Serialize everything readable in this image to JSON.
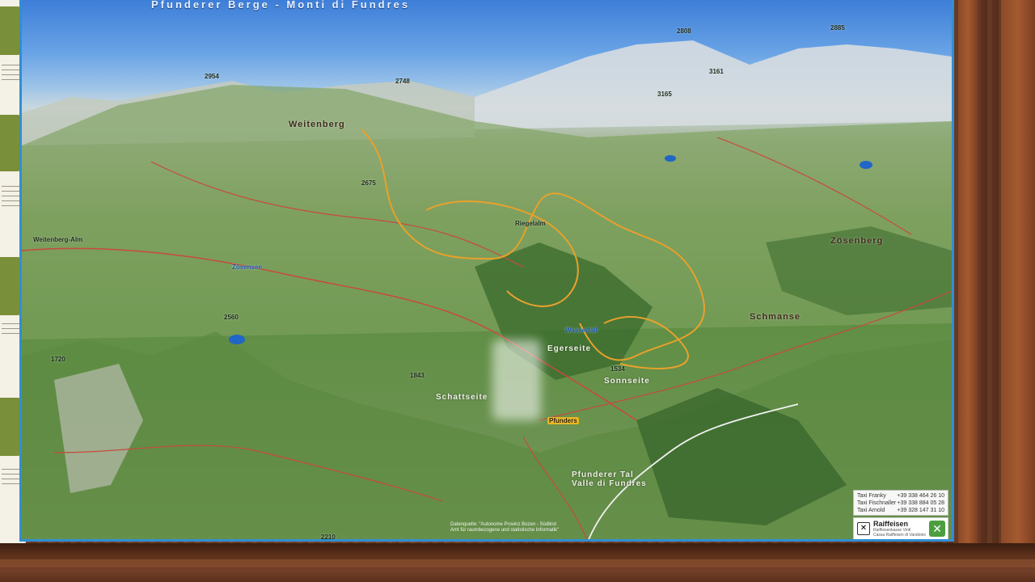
{
  "map": {
    "title": "Pfunderer Berge - Monti di Fundres",
    "regions": [
      {
        "id": "weitenberg",
        "text": "Weitenberg"
      },
      {
        "id": "zosenberg",
        "text": "Zösenberg"
      },
      {
        "id": "schmaus",
        "text": "Schmanse"
      },
      {
        "id": "sonnseite",
        "text": "Sonnseite"
      },
      {
        "id": "schattseite",
        "text": "Schattseite"
      },
      {
        "id": "egerseite",
        "text": "Egerseite"
      },
      {
        "id": "valley",
        "text": "Pfunderer Tal\nValle di Fundres"
      }
    ],
    "places": [
      {
        "id": "pfunders",
        "text": "Pfunders"
      },
      {
        "id": "wasserfall",
        "text": "Wasserfall"
      },
      {
        "id": "weissenbach",
        "text": "Weitenberg-Alm"
      },
      {
        "id": "zosen",
        "text": "Zösensee"
      },
      {
        "id": "riegelalm",
        "text": "Riegelalm"
      }
    ],
    "heights": [
      "2885",
      "2808",
      "3161",
      "3165",
      "2954",
      "2748",
      "2675",
      "2560",
      "1720",
      "1534",
      "1843",
      "2210"
    ]
  },
  "taxi": [
    {
      "name": "Taxi Franky",
      "phone": "+39 338 464 26 10"
    },
    {
      "name": "Taxi Fischnaller",
      "phone": "+39 338 884 05 28"
    },
    {
      "name": "Taxi Arnold",
      "phone": "+39 328 147 31 10"
    }
  ],
  "sponsor": {
    "name": "Raiffeisen",
    "line1": "Raiffeisenkasse Vintl",
    "line2": "Cassa Raiffeisen di Vandoies"
  },
  "source": {
    "line1": "Datenquelle: \"Autonome Provinz Bozen - Südtirol",
    "line2": "Amt für raumbezogene und statistische Informatik\""
  }
}
